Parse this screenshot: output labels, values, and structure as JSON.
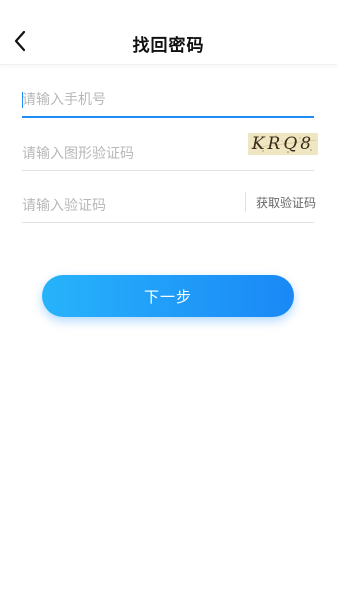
{
  "header": {
    "title": "找回密码",
    "back_icon": "chevron-left-icon"
  },
  "form": {
    "phone_placeholder": "请输入手机号",
    "image_code_placeholder": "请输入图形验证码",
    "captcha_text": "KRQ8",
    "sms_code_placeholder": "请输入验证码",
    "get_code_label": "获取验证码"
  },
  "actions": {
    "next_label": "下一步"
  },
  "colors": {
    "accent": "#1f8cf8",
    "button_gradient_start": "#27b3fb",
    "button_gradient_end": "#1a88f6"
  }
}
